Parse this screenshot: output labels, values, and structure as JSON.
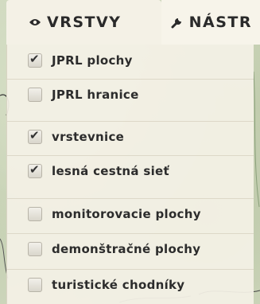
{
  "tabs": [
    {
      "label": "VRSTVY",
      "icon": "eye-icon"
    },
    {
      "label": "NÁSTR",
      "icon": "wrench-icon"
    }
  ],
  "layers": [
    {
      "label": "JPRL plochy",
      "checked": true
    },
    {
      "label": "JPRL hranice",
      "checked": false
    },
    {
      "label": "vrstevnice",
      "checked": true
    },
    {
      "label": "lesná cestná sieť",
      "checked": true
    },
    {
      "label": "monitorovacie plochy",
      "checked": false
    },
    {
      "label": "demonštračné plochy",
      "checked": false
    },
    {
      "label": "turistické chodníky",
      "checked": false
    }
  ]
}
